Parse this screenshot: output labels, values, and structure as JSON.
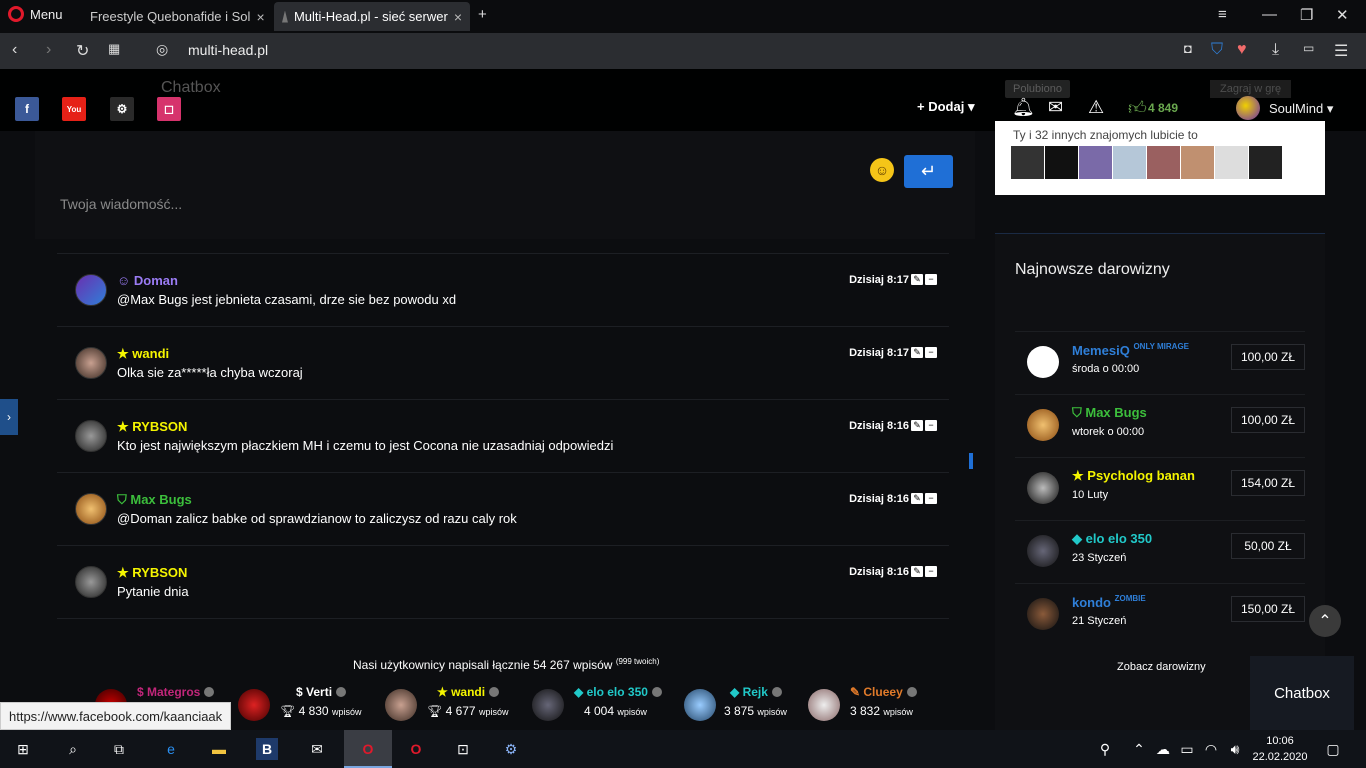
{
  "browser": {
    "menu_label": "Menu",
    "tabs": [
      {
        "title": "Freestyle Quebonafide i Sol"
      },
      {
        "title": "Multi-Head.pl - sieć serwer"
      }
    ],
    "url": "multi-head.pl",
    "status_url": "https://www.facebook.com/kaanciaak"
  },
  "header": {
    "chatbox_ghost": "Chatbox",
    "dodaj_label": "Dodaj",
    "likes": "4 849",
    "username": "SoulMind",
    "fb_like_ghost": "Polubiono",
    "zagraj_ghost": "Zagraj w grę"
  },
  "chat": {
    "placeholder": "Twoja wiadomość...",
    "messages": [
      {
        "name": "Doman",
        "color": "#9b7cf5",
        "icon": "gamepad-icon",
        "text": "@Max Bugs jest jebnieta czasami, drze sie bez powodu xd",
        "time": "Dzisiaj 8:17"
      },
      {
        "name": "wandi",
        "color": "#f5f500",
        "icon": "star-icon",
        "text": "Olka sie za*****ła chyba wczoraj",
        "time": "Dzisiaj 8:17"
      },
      {
        "name": "RYBSON",
        "color": "#f5f500",
        "icon": "star-icon",
        "text": "Kto jest największym płaczkiem MH i czemu to jest Cocona nie uzasadniaj odpowiedzi",
        "time": "Dzisiaj 8:16"
      },
      {
        "name": "Max Bugs",
        "color": "#3cbf3c",
        "icon": "shield-icon",
        "text": "@Doman zalicz babke od sprawdzianow to zaliczysz od razu caly rok",
        "time": "Dzisiaj 8:16"
      },
      {
        "name": "RYBSON",
        "color": "#f5f500",
        "icon": "star-icon",
        "text": "Pytanie dnia",
        "time": "Dzisiaj 8:16"
      }
    ]
  },
  "stats": {
    "line": "Nasi użytkownicy napisali łącznie 54 267 wpisów",
    "own": "(999 twoich)",
    "wpisow": "wpisów",
    "top_users": [
      {
        "name": "Mategros",
        "color": "#c2267a",
        "count": ""
      },
      {
        "name": "Verti",
        "color": "#ffffff",
        "count": "4 830"
      },
      {
        "name": "wandi",
        "color": "#f5f500",
        "count": "4 677"
      },
      {
        "name": "elo elo 350",
        "color": "#21c9c9",
        "count": "4 004"
      },
      {
        "name": "Rejk",
        "color": "#21c9c9",
        "count": "3 875"
      },
      {
        "name": "Clueey",
        "color": "#e07a2a",
        "count": "3 832"
      }
    ]
  },
  "facebook": {
    "friends_text": "Ty i 32 innych znajomych lubicie to"
  },
  "donations": {
    "title": "Najnowsze darowizny",
    "see_all": "Zobacz darowizny",
    "items": [
      {
        "name": "MemesiQ",
        "tag": "ONLY MIRAGE",
        "color": "#2f7fd8",
        "date": "środa o 00:00",
        "amount": "100,00 ZŁ"
      },
      {
        "name": "Max Bugs",
        "tag": "",
        "color": "#3cbf3c",
        "date": "wtorek o 00:00",
        "amount": "100,00 ZŁ"
      },
      {
        "name": "Psycholog banan",
        "tag": "",
        "color": "#f5f500",
        "date": "10 Luty",
        "amount": "154,00 ZŁ"
      },
      {
        "name": "elo elo 350",
        "tag": "",
        "color": "#21c9c9",
        "date": "23 Styczeń",
        "amount": "50,00 ZŁ"
      },
      {
        "name": "kondo",
        "tag": "ZOMBIE",
        "color": "#2f7fd8",
        "date": "21 Styczeń",
        "amount": "150,00 ZŁ"
      }
    ]
  },
  "sidebar_button": "Chatbox",
  "taskbar": {
    "time": "10:06",
    "date": "22.02.2020"
  }
}
